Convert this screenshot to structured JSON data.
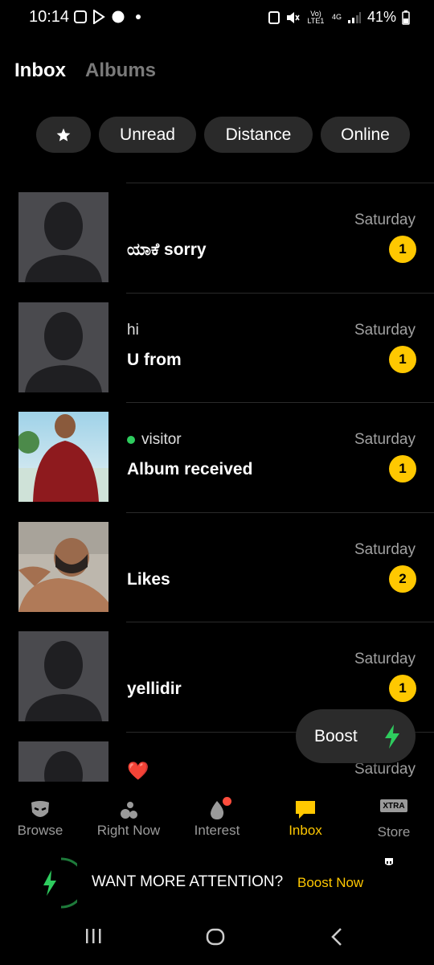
{
  "status_bar": {
    "time": "10:14",
    "network": "Vo) LTE1",
    "signal_type": "4G",
    "battery": "41%",
    "icons": [
      "instagram-icon",
      "play-store-icon",
      "whatsapp-icon",
      "dot-icon",
      "alarm-icon",
      "mute-icon",
      "volte-icon",
      "4g-icon",
      "signal-icon",
      "battery-icon"
    ]
  },
  "header": {
    "tabs": [
      {
        "label": "Inbox",
        "active": true
      },
      {
        "label": "Albums",
        "active": false
      }
    ]
  },
  "filters": {
    "star_icon": "star-icon",
    "chips": [
      "Unread",
      "Distance",
      "Online"
    ]
  },
  "conversations": [
    {
      "preview": "",
      "message": "ಯಾಕೆ sorry",
      "date": "Saturday",
      "unread": "1",
      "avatar": "placeholder-silhouette",
      "online": false
    },
    {
      "preview": "hi",
      "message": "U from",
      "date": "Saturday",
      "unread": "1",
      "avatar": "placeholder-silhouette",
      "online": false
    },
    {
      "preview": "visitor",
      "message": "Album received",
      "date": "Saturday",
      "unread": "1",
      "avatar": "photo-man-red-shirt",
      "online": true
    },
    {
      "preview": "",
      "message": "Likes",
      "date": "Saturday",
      "unread": "2",
      "avatar": "photo-man-lying",
      "online": false
    },
    {
      "preview": "",
      "message": "yellidir",
      "date": "Saturday",
      "unread": "1",
      "avatar": "placeholder-silhouette",
      "online": false
    },
    {
      "preview": "❤️",
      "message": "",
      "date": "Saturday",
      "unread": "",
      "avatar": "placeholder-silhouette",
      "online": false
    }
  ],
  "boost_fab": {
    "label": "Boost",
    "icon": "lightning-icon",
    "accent": "#2ecc5e"
  },
  "bottom_nav": [
    {
      "label": "Browse",
      "icon": "mask-icon",
      "active": false
    },
    {
      "label": "Right Now",
      "icon": "drops-icon",
      "active": false
    },
    {
      "label": "Interest",
      "icon": "flame-icon",
      "active": false,
      "notification": true
    },
    {
      "label": "Inbox",
      "icon": "chat-icon",
      "active": true
    },
    {
      "label": "Store",
      "icon": "xtra-icon",
      "active": false,
      "icon_text": "XTRA"
    }
  ],
  "banner": {
    "text": "WANT MORE ATTENTION?",
    "cta": "Boost Now",
    "icon": "lightning-icon"
  },
  "colors": {
    "background": "#000000",
    "accent": "#ffc800",
    "chip_bg": "#2a2a2a",
    "online": "#2ecc5e",
    "inactive_text": "#9a9a9a"
  }
}
